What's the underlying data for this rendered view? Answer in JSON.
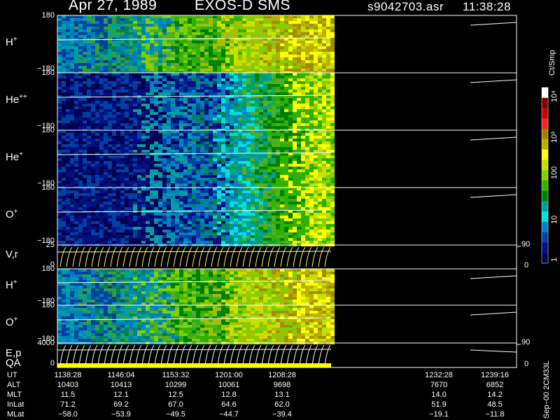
{
  "header": {
    "date": "Apr 27, 1989",
    "instrument": "EXOS-D SMS",
    "file": "s9042703.asr",
    "time": "11:38:28"
  },
  "colors": {
    "background": "#000000",
    "foreground": "#ffffff",
    "speed_lines": "#ffff66"
  },
  "panels": [
    {
      "id": "h-plus",
      "name": "H",
      "charge": "+",
      "ytop": "180",
      "ybot": "−180",
      "kind": "spectrogram"
    },
    {
      "id": "he-pp",
      "name": "He",
      "charge": "++",
      "ytop": "180",
      "ybot": "−180",
      "kind": "spectrogram"
    },
    {
      "id": "he-plus",
      "name": "He",
      "charge": "+",
      "ytop": "180",
      "ybot": "−180",
      "kind": "spectrogram"
    },
    {
      "id": "o-plus",
      "name": "O",
      "charge": "+",
      "ytop": "180",
      "ybot": "−180",
      "kind": "spectrogram"
    },
    {
      "id": "v-r",
      "name": "V,r",
      "charge": "",
      "ytop": "25",
      "ybot": "0",
      "rtop": "90",
      "rbot": "0",
      "kind": "lines"
    },
    {
      "id": "h-plus-2",
      "name": "H",
      "charge": "+",
      "ytop": "180",
      "ybot": "−180",
      "kind": "spectrogram"
    },
    {
      "id": "o-plus-2",
      "name": "O",
      "charge": "+",
      "ytop": "180",
      "ybot": "−180",
      "kind": "spectrogram"
    },
    {
      "id": "e-p",
      "name": "E,p",
      "charge": "",
      "ytop": "4000",
      "ybot": "0",
      "rtop": "90",
      "rbot": "0",
      "kind": "lines"
    }
  ],
  "qa_label": "QA",
  "colorbar": {
    "title": "Ct/Smp",
    "ticks": [
      "10⁴",
      "10³",
      "100",
      "10",
      "1"
    ],
    "stops": [
      "#ffffff",
      "#800000",
      "#cc0000",
      "#ff2020",
      "#a08000",
      "#b8b000",
      "#ffff00",
      "#c8e000",
      "#80d000",
      "#30b000",
      "#008000",
      "#00a0a0",
      "#00e0e0",
      "#0080c0",
      "#0040a0",
      "#001080",
      "#000050"
    ]
  },
  "footer": {
    "rows": [
      {
        "name": "UT",
        "values": [
          "1138:28",
          "1146:04",
          "1153:32",
          "1201:00",
          "1208:28",
          "1232:28",
          "1239:16"
        ]
      },
      {
        "name": "ALT",
        "values": [
          "10403",
          "10413",
          "10299",
          "10061",
          "9698",
          "7670",
          "6852"
        ]
      },
      {
        "name": "MLT",
        "values": [
          "11.5",
          "12.1",
          "12.5",
          "12.8",
          "13.1",
          "14.0",
          "14.2"
        ]
      },
      {
        "name": "InLat",
        "values": [
          "71.2",
          "69.2",
          "67.0",
          "64.6",
          "62.0",
          "51.9",
          "48.5"
        ]
      },
      {
        "name": "MLat",
        "values": [
          "−58.0",
          "−53.9",
          "−49.5",
          "−44.7",
          "−39.4",
          "−19.1",
          "−11.8"
        ]
      }
    ],
    "stamp": "Sep−00  2CM33L"
  },
  "chart_data": {
    "type": "heatmap",
    "title": "Apr 27, 1989   EXOS-D SMS",
    "x_ticks": [
      "1138:28",
      "1146:04",
      "1153:32",
      "1201:00",
      "1208:28",
      "1232:28",
      "1239:16"
    ],
    "series": [
      {
        "name": "H+",
        "ylim": [
          -180,
          180
        ]
      },
      {
        "name": "He++",
        "ylim": [
          -180,
          180
        ]
      },
      {
        "name": "He+",
        "ylim": [
          -180,
          180
        ]
      },
      {
        "name": "O+",
        "ylim": [
          -180,
          180
        ]
      },
      {
        "name": "V,r",
        "ylim": [
          0,
          25
        ],
        "right_ylim": [
          0,
          90
        ]
      },
      {
        "name": "H+",
        "ylim": [
          -180,
          180
        ]
      },
      {
        "name": "O+",
        "ylim": [
          -180,
          180
        ]
      },
      {
        "name": "E,p",
        "ylim": [
          0,
          4000
        ],
        "right_ylim": [
          0,
          90
        ]
      }
    ],
    "colorbar_label": "Ct/Smp",
    "colorbar_ticks": [
      "1",
      "10",
      "100",
      "10³",
      "10⁴"
    ],
    "grid": false
  }
}
